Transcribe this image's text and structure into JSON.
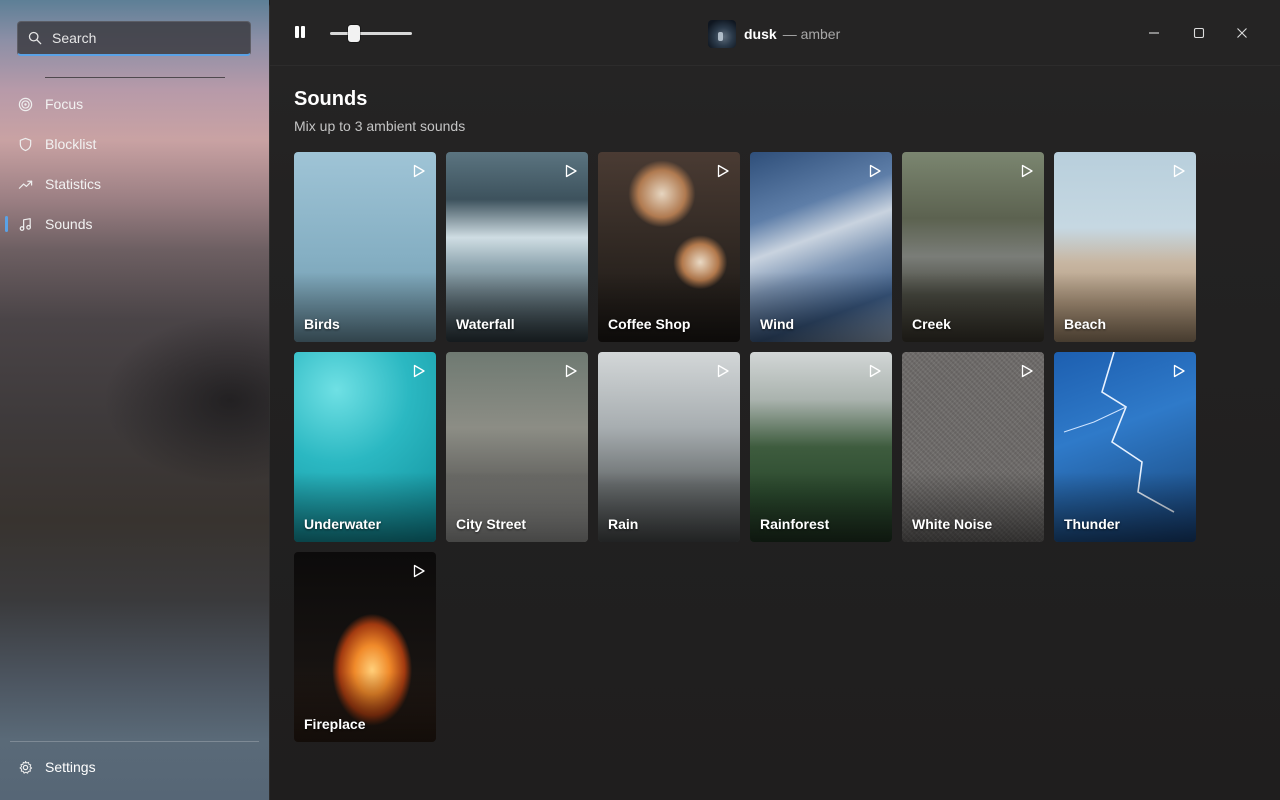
{
  "sidebar": {
    "search": {
      "placeholder": "Search",
      "value": ""
    },
    "items": [
      {
        "label": "Focus",
        "icon": "focus-target-icon",
        "active": false
      },
      {
        "label": "Blocklist",
        "icon": "shield-icon",
        "active": false
      },
      {
        "label": "Statistics",
        "icon": "trending-chart-icon",
        "active": false
      },
      {
        "label": "Sounds",
        "icon": "music-note-icon",
        "active": true
      }
    ],
    "settings_label": "Settings"
  },
  "titlebar": {
    "now_playing": {
      "track": "dusk",
      "artist": "— amber"
    },
    "playback_state": "playing",
    "volume_fraction": 0.25
  },
  "page": {
    "title": "Sounds",
    "subtitle": "Mix up to 3 ambient sounds"
  },
  "sounds": [
    {
      "label": "Birds"
    },
    {
      "label": "Waterfall"
    },
    {
      "label": "Coffee Shop"
    },
    {
      "label": "Wind"
    },
    {
      "label": "Creek"
    },
    {
      "label": "Beach"
    },
    {
      "label": "Underwater"
    },
    {
      "label": "City Street"
    },
    {
      "label": "Rain"
    },
    {
      "label": "Rainforest"
    },
    {
      "label": "White Noise"
    },
    {
      "label": "Thunder"
    },
    {
      "label": "Fireplace"
    }
  ],
  "colors": {
    "accent": "#5aa2e6",
    "main_background": "#232222"
  }
}
